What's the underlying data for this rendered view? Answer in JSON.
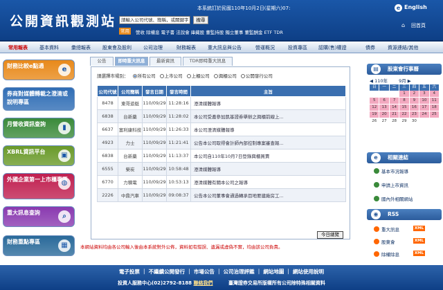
{
  "header": {
    "title": "公開資訊觀測站",
    "notice": "本系統訂於民國110年10月2日(星期六)07:",
    "search_placeholder": "請輸入公司代號、簡稱，或關鍵字",
    "search_button": "搜尋",
    "common_label": "常用",
    "quick_links": "營收 除權息 電子書 法說會 庫藏股 董監持股 獨立董事 董監酬金 ETF TDR",
    "english": "English",
    "home": "回首頁"
  },
  "nav": [
    "常用報表",
    "基本資料",
    "彙總報表",
    "股東會及股利",
    "公司治理",
    "財務報表",
    "重大訊息與公告",
    "營運概況",
    "投資專區",
    "認購(售)權證",
    "債券",
    "資源連結/其他"
  ],
  "sidebar": [
    {
      "label": "財務比較e點通",
      "color": "#e8891a"
    },
    {
      "label": "券商對媒體轉載之澄清或說明專區",
      "color": "#2f6db5"
    },
    {
      "label": "月營收資訊查詢",
      "color": "#3a8a3a"
    },
    {
      "label": "XBRL資訊平台",
      "color": "#6a9a2a"
    },
    {
      "label": "外國企業第一上市櫃專區",
      "color": "#c02050"
    },
    {
      "label": "重大訊息查詢",
      "color": "#8a3ab0"
    },
    {
      "label": "財務重點專區",
      "color": "#2a6a9a"
    }
  ],
  "tabs": [
    "公告",
    "即時重大訊息",
    "最新資訊",
    "TDR即時重大訊息"
  ],
  "filter": {
    "label": "請選擇市場別：",
    "options": [
      "所有公司",
      "上市公司",
      "上櫃公司",
      "興櫃公司",
      "公開發行公司"
    ]
  },
  "table": {
    "headers": [
      "公司代號",
      "公司簡稱",
      "發言日期",
      "發言時間",
      "主旨"
    ],
    "rows": [
      [
        "8478",
        "東哥遊艇",
        "110/09/29",
        "11:28:16",
        "澄清媒體報導"
      ],
      [
        "6838",
        "台新藥",
        "110/09/29",
        "11:28:02",
        "本公司受邀參加凱基證券舉辦之興櫃前線上..."
      ],
      [
        "6637",
        "富利康科技",
        "110/09/29",
        "11:26:33",
        "本公司澄清媒體報導"
      ],
      [
        "4923",
        "力士",
        "110/09/29",
        "11:21:41",
        "公告本公司取得會計師內部控制專案審查報..."
      ],
      [
        "6838",
        "台新藥",
        "110/09/29",
        "11:13:37",
        "本公司自110年10月7日登錄興櫃買賣"
      ],
      [
        "6555",
        "榮炭",
        "110/09/29",
        "10:58:48",
        "澄清媒體報導"
      ],
      [
        "6770",
        "力積電",
        "110/09/29",
        "10:53:13",
        "澄清媒體有關本公司之報導"
      ],
      [
        "2226",
        "中鼎汽車",
        "110/09/29",
        "09:08:37",
        "公告本公司董事會通過轉承目地要建廠房工..."
      ]
    ]
  },
  "today_button": "今日總覽",
  "disclaimer": "本網站資料均由各公司輸入後由本系統對外公佈，資料如有錯誤、遺漏或虛偽不實，均由該公司負責。",
  "calendar": {
    "title": "股東會行事曆",
    "year": "110",
    "year_unit": "年",
    "month": "9",
    "month_unit": "月",
    "weekdays": [
      "日",
      "一",
      "二",
      "三",
      "四",
      "五",
      "六"
    ],
    "days": [
      "",
      "",
      "",
      "1",
      "2",
      "3",
      "4",
      "5",
      "6",
      "7",
      "8",
      "9",
      "10",
      "11",
      "12",
      "13",
      "14",
      "15",
      "16",
      "17",
      "18",
      "19",
      "20",
      "21",
      "22",
      "23",
      "24",
      "25",
      "26",
      "27",
      "28",
      "29",
      "30",
      "",
      ""
    ]
  },
  "related": {
    "title": "相關連結",
    "links": [
      "基本市況報導",
      "申請上市資訊",
      "國內外相關網站"
    ]
  },
  "rss": {
    "title": "RSS",
    "items": [
      "重大訊息",
      "股東會",
      "除權除息"
    ],
    "badge": "XML"
  },
  "footer": {
    "links": "電子投票 ｜ 不繼續公開發行 ｜ 市場公告 ｜ 公司治理評鑑 ｜ 網站地圖 ｜ 網站使用說明",
    "info": "投資人服務中心(02)2792-8188",
    "contact": "聯絡我們",
    "org": "臺灣證券交易所版權所有公司除特殊相關資料"
  }
}
